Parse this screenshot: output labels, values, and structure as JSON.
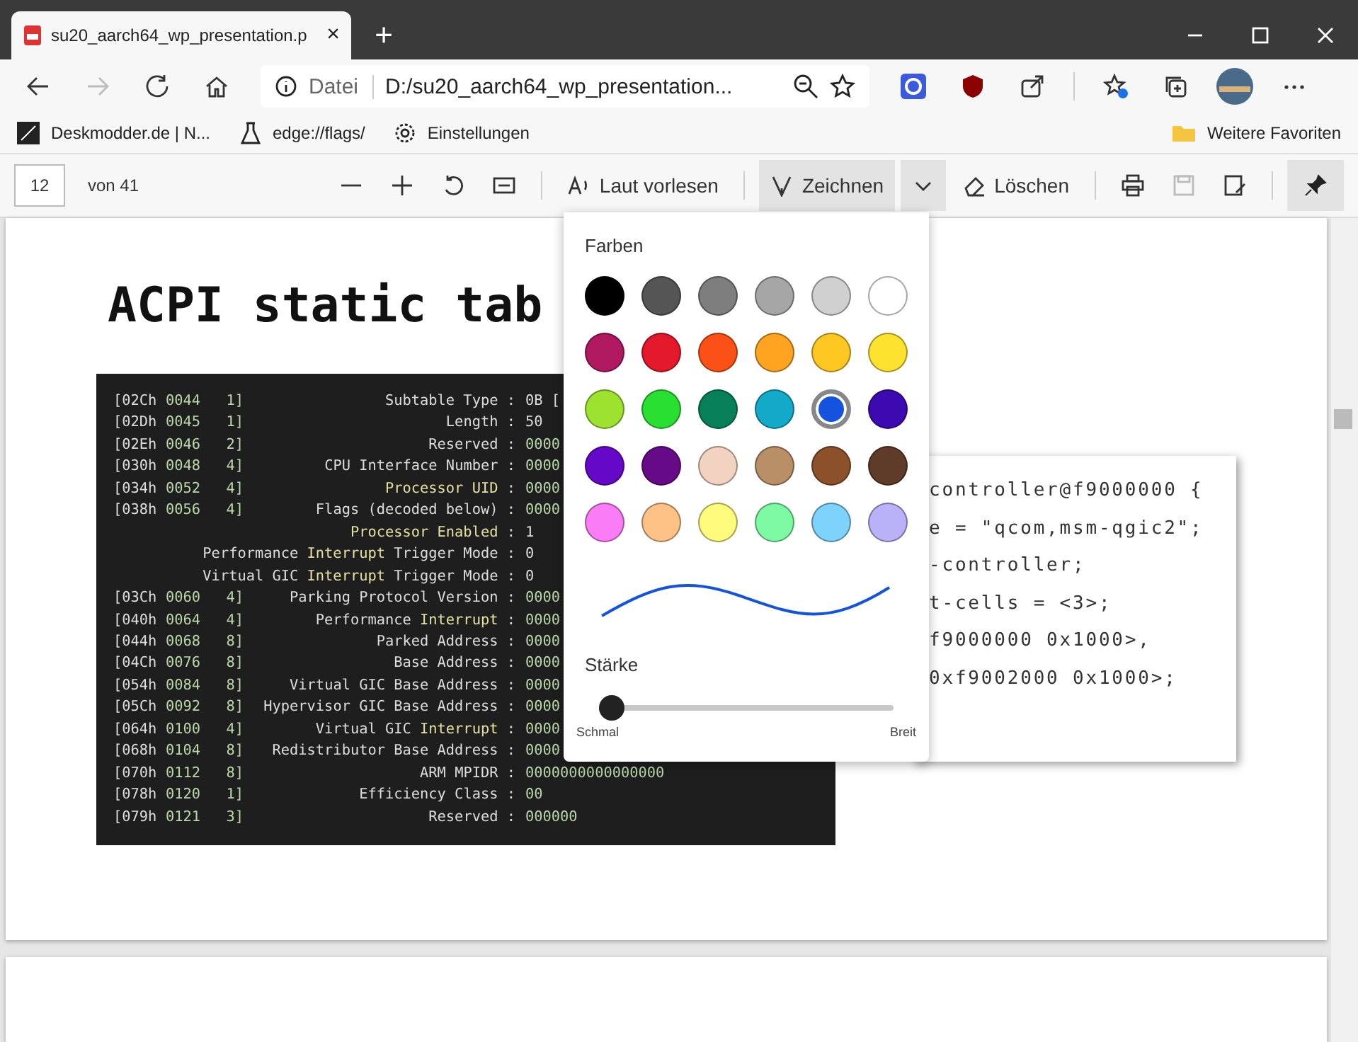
{
  "tab": {
    "title": "su20_aarch64_wp_presentation.p",
    "close": "×",
    "new_tab": "+"
  },
  "address_bar": {
    "scheme": "Datei",
    "url": "D:/su20_aarch64_wp_presentation..."
  },
  "favorites": [
    {
      "label": "Deskmodder.de | N..."
    },
    {
      "label": "edge://flags/"
    },
    {
      "label": "Einstellungen"
    }
  ],
  "favorites_more": "Weitere Favoriten",
  "pdf_toolbar": {
    "page": "12",
    "page_count": "von 41",
    "read_aloud": "Laut vorlesen",
    "draw": "Zeichnen",
    "draw_active": true,
    "erase": "Löschen",
    "save_disabled": true,
    "pinned": true
  },
  "slide": {
    "title": "ACPI static tab",
    "terminal_rows": [
      {
        "offset": "[02Ch",
        "dec": "0044",
        "len": "1]",
        "label": [
          {
            "text": "Subtable Type :",
            "hl": false
          }
        ],
        "value": "0B [",
        "value_hl": false
      },
      {
        "offset": "[02Dh",
        "dec": "0045",
        "len": "1]",
        "label": [
          {
            "text": "Length :",
            "hl": false
          }
        ],
        "value": "50",
        "value_hl": false
      },
      {
        "offset": "[02Eh",
        "dec": "0046",
        "len": "2]",
        "label": [
          {
            "text": "Reserved :",
            "hl": false
          }
        ],
        "value": "0000",
        "value_hl": true
      },
      {
        "offset": "[030h",
        "dec": "0048",
        "len": "4]",
        "label": [
          {
            "text": "CPU Interface Number :",
            "hl": false
          }
        ],
        "value": "0000",
        "value_hl": true
      },
      {
        "offset": "[034h",
        "dec": "0052",
        "len": "4]",
        "label": [
          {
            "text": "Processor UID",
            "hl": true
          },
          {
            "text": " :",
            "hl": false
          }
        ],
        "value": "0000",
        "value_hl": true
      },
      {
        "offset": "[038h",
        "dec": "0056",
        "len": "4]",
        "label": [
          {
            "text": "Flags (decoded below) :",
            "hl": false
          }
        ],
        "value": "0000",
        "value_hl": true
      },
      {
        "label": [
          {
            "text": "Processor Enabled",
            "hl": true
          },
          {
            "text": " :",
            "hl": false
          }
        ],
        "value": "1",
        "value_hl": false
      },
      {
        "label": [
          {
            "text": "Performance ",
            "hl": false
          },
          {
            "text": "Interrupt",
            "hl": true
          },
          {
            "text": " Trigger Mode :",
            "hl": false
          }
        ],
        "value": "0",
        "value_hl": false
      },
      {
        "label": [
          {
            "text": "Virtual GIC ",
            "hl": false
          },
          {
            "text": "Interrupt",
            "hl": true
          },
          {
            "text": " Trigger Mode :",
            "hl": false
          }
        ],
        "value": "0",
        "value_hl": false
      },
      {
        "offset": "[03Ch",
        "dec": "0060",
        "len": "4]",
        "label": [
          {
            "text": "Parking Protocol Version :",
            "hl": false
          }
        ],
        "value": "0000",
        "value_hl": true
      },
      {
        "offset": "[040h",
        "dec": "0064",
        "len": "4]",
        "label": [
          {
            "text": "Performance ",
            "hl": false
          },
          {
            "text": "Interrupt",
            "hl": true
          },
          {
            "text": " :",
            "hl": false
          }
        ],
        "value": "0000",
        "value_hl": true
      },
      {
        "offset": "[044h",
        "dec": "0068",
        "len": "8]",
        "label": [
          {
            "text": "Parked Address :",
            "hl": false
          }
        ],
        "value": "0000",
        "value_hl": true
      },
      {
        "offset": "[04Ch",
        "dec": "0076",
        "len": "8]",
        "label": [
          {
            "text": "Base Address :",
            "hl": false
          }
        ],
        "value": "0000",
        "value_hl": true
      },
      {
        "offset": "[054h",
        "dec": "0084",
        "len": "8]",
        "label": [
          {
            "text": "Virtual GIC Base Address :",
            "hl": false
          }
        ],
        "value": "0000",
        "value_hl": true
      },
      {
        "offset": "[05Ch",
        "dec": "0092",
        "len": "8]",
        "label": [
          {
            "text": "Hypervisor GIC Base Address :",
            "hl": false
          }
        ],
        "value": "0000",
        "value_hl": true
      },
      {
        "offset": "[064h",
        "dec": "0100",
        "len": "4]",
        "label": [
          {
            "text": "Virtual GIC ",
            "hl": false
          },
          {
            "text": "Interrupt",
            "hl": true
          },
          {
            "text": " :",
            "hl": false
          }
        ],
        "value": "0000",
        "value_hl": true
      },
      {
        "offset": "[068h",
        "dec": "0104",
        "len": "8]",
        "label": [
          {
            "text": "Redistributor Base Address :",
            "hl": false
          }
        ],
        "value": "0000",
        "value_hl": true
      },
      {
        "offset": "[070h",
        "dec": "0112",
        "len": "8]",
        "label": [
          {
            "text": "ARM MPIDR :",
            "hl": false
          }
        ],
        "value": "0000000000000000",
        "value_hl": true
      },
      {
        "offset": "[078h",
        "dec": "0120",
        "len": "1]",
        "label": [
          {
            "text": "Efficiency Class :",
            "hl": false
          }
        ],
        "value": "00",
        "value_hl": true
      },
      {
        "offset": "[079h",
        "dec": "0121",
        "len": "3]",
        "label": [
          {
            "text": "Reserved :",
            "hl": false
          }
        ],
        "value": "000000",
        "value_hl": true
      }
    ],
    "code_lines": [
      "controller@f9000000 {",
      "e = \"qcom,msm-qgic2\";",
      "-controller;",
      "t-cells = <3>;",
      "f9000000 0x1000>,",
      "0xf9002000 0x1000>;"
    ]
  },
  "draw_menu": {
    "colors_label": "Farben",
    "swatches": [
      {
        "color": "#000000",
        "selected": false
      },
      {
        "color": "#555555",
        "selected": false
      },
      {
        "color": "#7e7e7e",
        "selected": false
      },
      {
        "color": "#a6a6a6",
        "selected": false
      },
      {
        "color": "#d0d0d0",
        "selected": false
      },
      {
        "color": "#ffffff",
        "selected": false
      },
      {
        "color": "#b0185f",
        "selected": false
      },
      {
        "color": "#e3182a",
        "selected": false
      },
      {
        "color": "#fb5116",
        "selected": false
      },
      {
        "color": "#fea420",
        "selected": false
      },
      {
        "color": "#fec722",
        "selected": false
      },
      {
        "color": "#fde22f",
        "selected": false
      },
      {
        "color": "#9de22f",
        "selected": false
      },
      {
        "color": "#29e032",
        "selected": false
      },
      {
        "color": "#07805a",
        "selected": false
      },
      {
        "color": "#13a9c8",
        "selected": false
      },
      {
        "color": "#1453dd",
        "selected": true
      },
      {
        "color": "#3c0ab0",
        "selected": false
      },
      {
        "color": "#6608c8",
        "selected": false
      },
      {
        "color": "#670a88",
        "selected": false
      },
      {
        "color": "#f2d3c1",
        "selected": false
      },
      {
        "color": "#b98f68",
        "selected": false
      },
      {
        "color": "#8c502b",
        "selected": false
      },
      {
        "color": "#5f3c2a",
        "selected": false
      },
      {
        "color": "#fb7cf7",
        "selected": false
      },
      {
        "color": "#fec186",
        "selected": false
      },
      {
        "color": "#fefb7d",
        "selected": false
      },
      {
        "color": "#7dfaa3",
        "selected": false
      },
      {
        "color": "#7dd3fc",
        "selected": false
      },
      {
        "color": "#b9b2f9",
        "selected": false
      }
    ],
    "thickness_label": "Stärke",
    "thickness": {
      "level": 0.0,
      "min_label": "Schmal",
      "max_label": "Breit"
    }
  }
}
